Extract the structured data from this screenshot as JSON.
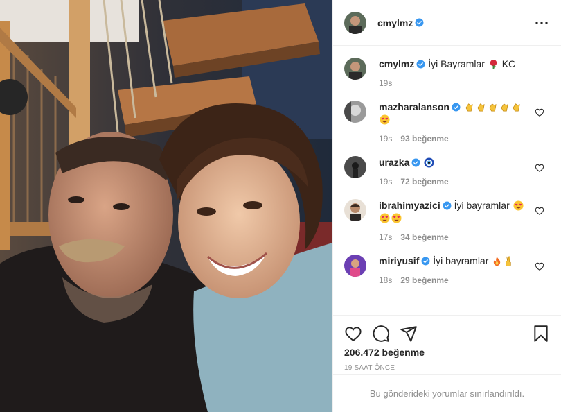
{
  "post": {
    "author": "cmylmz",
    "caption": {
      "username": "cmylmz",
      "text_before": "İyi Bayramlar",
      "text_after": "KC",
      "emoji": "rose",
      "age": "19s"
    },
    "comments": [
      {
        "username": "mazharalanson",
        "verified": true,
        "emojis_line1": [
          "clap",
          "clap",
          "clap",
          "clap",
          "clap"
        ],
        "emojis_line2": [
          "heart-eyes"
        ],
        "age": "19s",
        "likes": "93 beğenme"
      },
      {
        "username": "urazka",
        "verified": true,
        "emojis_line1": [
          "evil-eye"
        ],
        "age": "19s",
        "likes": "72 beğenme"
      },
      {
        "username": "ibrahimyazici",
        "verified": true,
        "text": "İyi bayramlar",
        "emojis_line1": [
          "heart-eyes"
        ],
        "emojis_line2": [
          "heart-eyes",
          "heart-eyes"
        ],
        "age": "17s",
        "likes": "34 beğenme"
      },
      {
        "username": "miriyusif",
        "verified": true,
        "text": "İyi bayramlar",
        "emojis_line1": [
          "fire",
          "victory"
        ],
        "age": "18s",
        "likes": "29 beğenme"
      }
    ],
    "likes_total": "206.472 beğenme",
    "timestamp": "19 SAAT ÖNCE",
    "comments_restricted": "Bu gönderideki yorumlar sınırlandırıldı."
  },
  "icons": {
    "more": "more-options-icon",
    "like": "heart-icon",
    "comment": "comment-icon",
    "share": "share-icon",
    "save": "bookmark-icon",
    "verified": "verified-badge-icon"
  },
  "colors": {
    "verified": "#3897f0",
    "text": "#262626",
    "muted": "#8e8e8e",
    "divider": "#efefef"
  }
}
